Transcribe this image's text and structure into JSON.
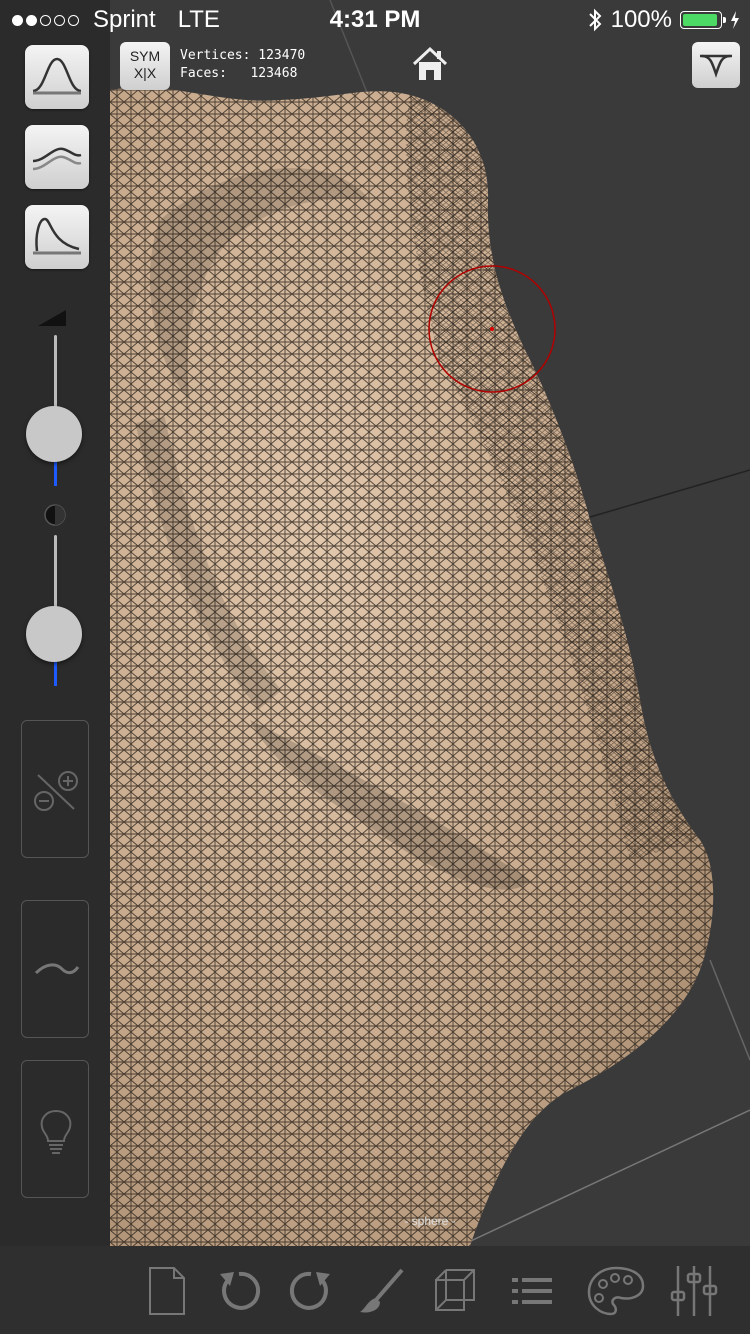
{
  "status_bar": {
    "carrier": "Sprint",
    "network": "LTE",
    "signal_bars": 2,
    "time": "4:31 PM",
    "battery_percent": "100%",
    "battery_color": "#4cd964"
  },
  "symmetry": {
    "line1": "SYM",
    "line2": "X|X"
  },
  "mesh_info": {
    "vertices": "Vertices: 123470",
    "faces": "Faces:   123468"
  },
  "object_label": "- sphere -",
  "sidebar": {
    "tools": [
      "brush-falloff-icon",
      "stroke-smooth-icon",
      "falloff-curve-icon"
    ],
    "radius_slider": {
      "icon": "radius-triangle-icon",
      "value": 0.27
    },
    "intensity_slider": {
      "icon": "contrast-icon",
      "value": 0.2
    },
    "panels": [
      "add-subtract-toggle-icon",
      "smooth-wave-icon",
      "lightbulb-icon"
    ]
  },
  "toolbar": {
    "items": [
      "new-file-icon",
      "undo-icon",
      "redo-icon",
      "brush-icon",
      "wireframe-cube-icon",
      "list-icon",
      "palette-icon",
      "sliders-icon"
    ]
  },
  "colors": {
    "accent": "#1e5bff",
    "mesh_skin": "#c9ac8f",
    "cursor": "#b00000"
  }
}
